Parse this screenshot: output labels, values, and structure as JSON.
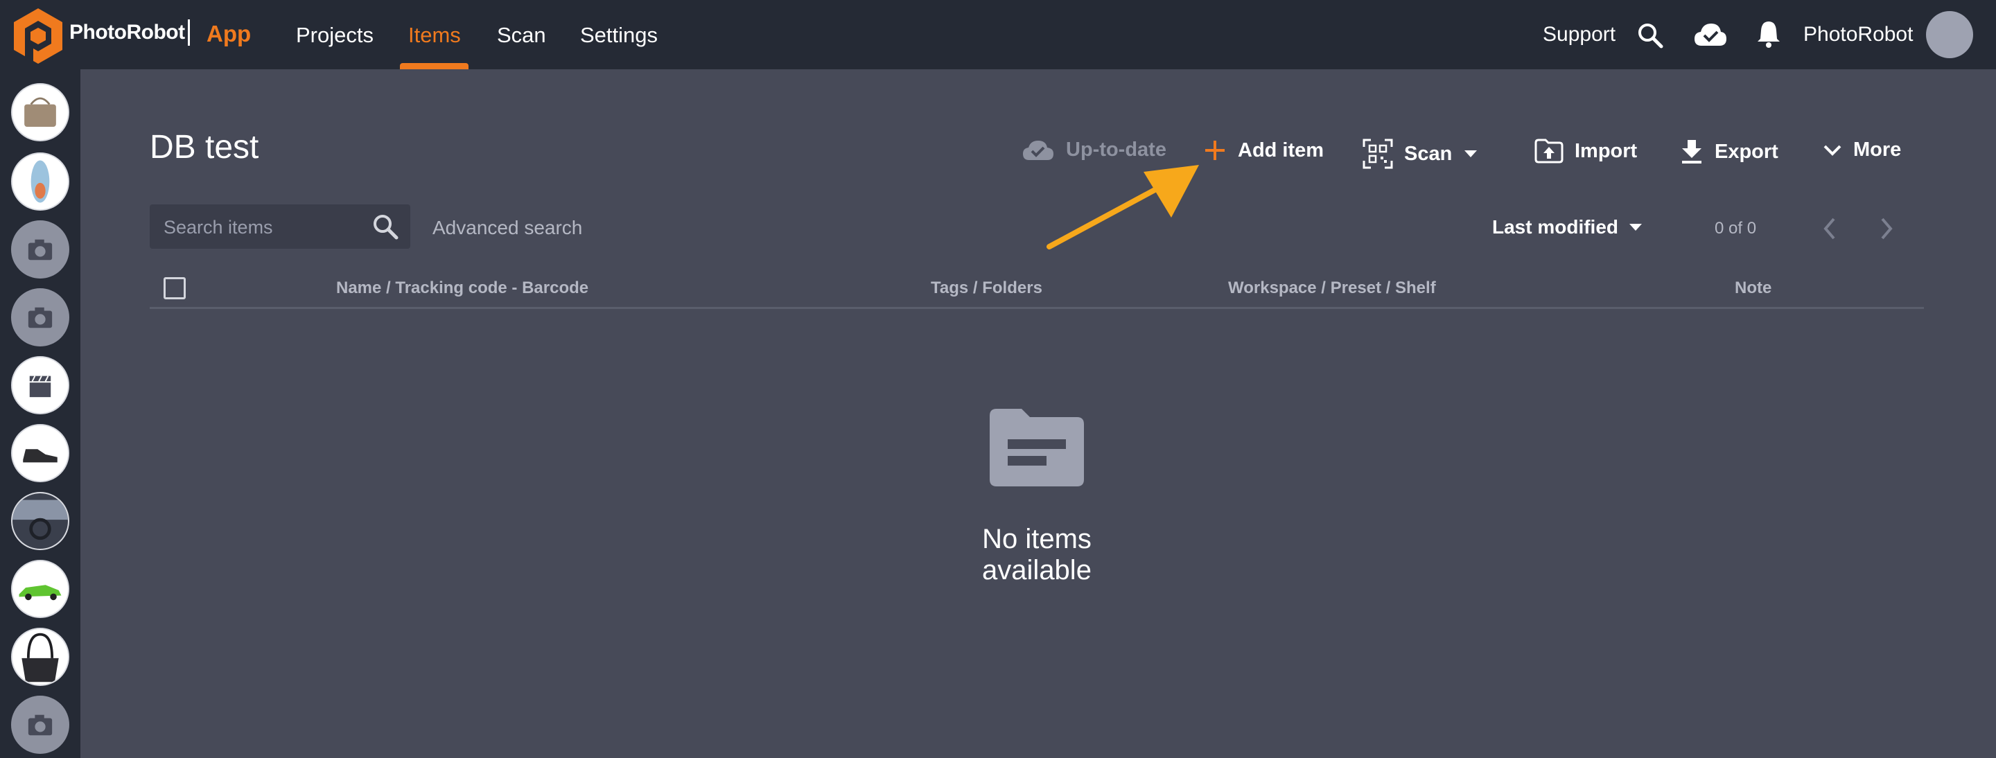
{
  "header": {
    "brand": "PhotoRobot",
    "app_label": "App",
    "nav": [
      {
        "label": "Projects",
        "active": false
      },
      {
        "label": "Items",
        "active": true
      },
      {
        "label": "Scan",
        "active": false
      },
      {
        "label": "Settings",
        "active": false
      }
    ],
    "support_label": "Support",
    "user_name": "PhotoRobot",
    "icons": [
      "search-icon",
      "cloud-check-icon",
      "bell-icon"
    ]
  },
  "sidebar": {
    "items": [
      {
        "kind": "handbag-thumbnail"
      },
      {
        "kind": "shoe-sole-thumbnail"
      },
      {
        "kind": "camera-icon"
      },
      {
        "kind": "camera-icon"
      },
      {
        "kind": "clapperboard-icon"
      },
      {
        "kind": "shoe-thumbnail"
      },
      {
        "kind": "car-interior-thumbnail"
      },
      {
        "kind": "green-car-thumbnail"
      },
      {
        "kind": "bag-thumbnail"
      },
      {
        "kind": "camera-icon"
      }
    ]
  },
  "page": {
    "title": "DB test",
    "toolbar": {
      "status": "Up-to-date",
      "add_item": "Add item",
      "scan": "Scan",
      "import": "Import",
      "export": "Export",
      "more": "More"
    },
    "search": {
      "placeholder": "Search items",
      "advanced": "Advanced search"
    },
    "sort": {
      "selected": "Last modified"
    },
    "pager": {
      "count": "0 of 0"
    },
    "table": {
      "columns": [
        "Name / Tracking code - Barcode",
        "Tags / Folders",
        "Workspace / Preset / Shelf",
        "Note"
      ]
    },
    "empty_message": "No items available"
  },
  "colors": {
    "accent": "#f07a1e",
    "topbar_bg": "#252a35",
    "content_bg": "#474a58",
    "annotation_arrow": "#f7a81b"
  }
}
